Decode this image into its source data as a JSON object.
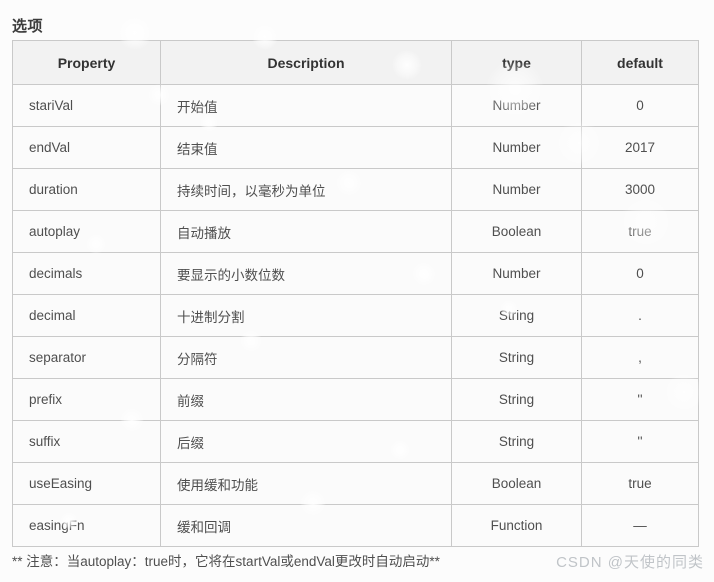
{
  "page": {
    "title": "选项"
  },
  "table": {
    "columns": [
      {
        "key": "property",
        "label": "Property"
      },
      {
        "key": "description",
        "label": "Description"
      },
      {
        "key": "type",
        "label": "type"
      },
      {
        "key": "default",
        "label": "default"
      }
    ],
    "rows": [
      {
        "property": "stariVal",
        "description": "开始值",
        "type": "Number",
        "default": "0"
      },
      {
        "property": "endVal",
        "description": "结束值",
        "type": "Number",
        "default": "2017"
      },
      {
        "property": "duration",
        "description": "持续时间，以毫秒为单位",
        "type": "Number",
        "default": "3000"
      },
      {
        "property": "autoplay",
        "description": "自动播放",
        "type": "Boolean",
        "default": "true"
      },
      {
        "property": "decimals",
        "description": "要显示的小数位数",
        "type": "Number",
        "default": "0"
      },
      {
        "property": "decimal",
        "description": "十进制分割",
        "type": "String",
        "default": "."
      },
      {
        "property": "separator",
        "description": "分隔符",
        "type": "String",
        "default": ","
      },
      {
        "property": "prefix",
        "description": "前缀",
        "type": "String",
        "default": "''"
      },
      {
        "property": "suffix",
        "description": "后缀",
        "type": "String",
        "default": "''"
      },
      {
        "property": "useEasing",
        "description": "使用缓和功能",
        "type": "Boolean",
        "default": "true"
      },
      {
        "property": "easingFn",
        "description": "缓和回调",
        "type": "Function",
        "default": "—"
      }
    ]
  },
  "footnote": {
    "text": "** 注意：当autoplay：true时，它将在startVal或endVal更改时自动启动**"
  },
  "watermark": {
    "text": "CSDN @天使的同类"
  },
  "colors": {
    "page_background": "#fcfcfc",
    "header_background": "#f2f2f2",
    "cell_background": "#fbfbfb",
    "border": "#c9c9c9",
    "text": "#4f4f4f",
    "heading_text": "#333333",
    "watermark_text": "#c0c4c8"
  }
}
